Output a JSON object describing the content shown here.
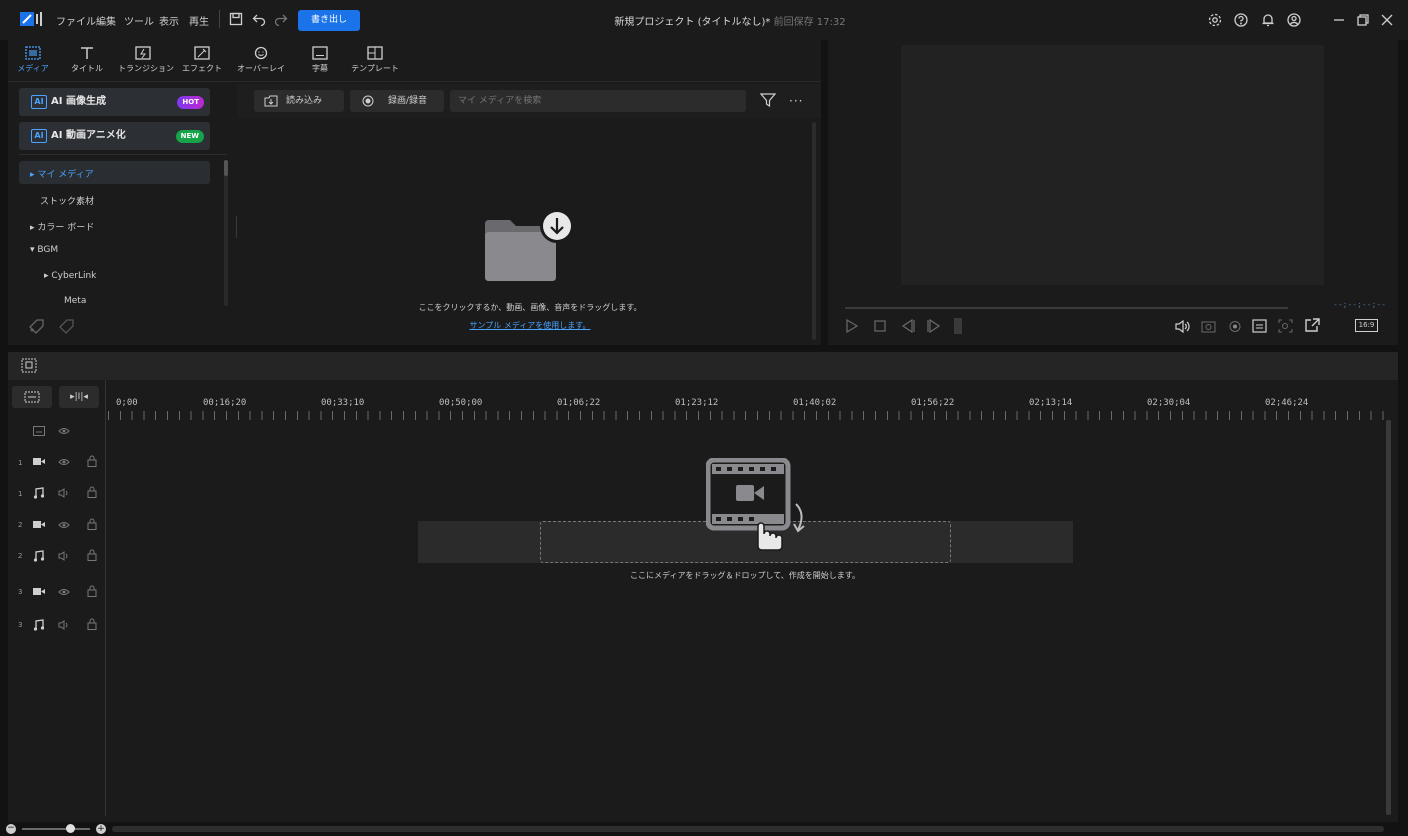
{
  "titlebar": {
    "menu": [
      "ファイル",
      "編集",
      "ツール",
      "表示",
      "再生"
    ],
    "export_label": "書き出し",
    "project_title": "新規プロジェクト (タイトルなし)*",
    "last_saved": "前回保存 17:32"
  },
  "tabs": [
    {
      "label": "メディア",
      "icon": "media-icon"
    },
    {
      "label": "タイトル",
      "icon": "title-icon"
    },
    {
      "label": "トランジション",
      "icon": "transition-icon"
    },
    {
      "label": "エフェクト",
      "icon": "effect-icon"
    },
    {
      "label": "オーバーレイ",
      "icon": "overlay-icon"
    },
    {
      "label": "字幕",
      "icon": "subtitle-icon"
    },
    {
      "label": "テンプレート",
      "icon": "template-icon"
    }
  ],
  "sidebar": {
    "ai_image": {
      "label": "AI 画像生成",
      "badge": "HOT"
    },
    "ai_anime": {
      "label": "AI 動画アニメ化",
      "badge": "NEW"
    },
    "items": [
      "▸ マイ メディア",
      "ストック素材",
      "▸ カラー ボード",
      "▾ BGM",
      "▸ CyberLink",
      "Meta"
    ]
  },
  "media_toolbar": {
    "import_label": "読み込み",
    "record_label": "録画/録音",
    "search_placeholder": "マイ メディアを検索"
  },
  "media_empty": {
    "hint": "ここをクリックするか、動画、画像、音声をドラッグします。",
    "sample_link": "サンプル メディアを使用します。"
  },
  "preview": {
    "timecode": "--;--;--;--",
    "aspect": "16:9"
  },
  "timeline": {
    "ticks": [
      "0;00",
      "00;16;20",
      "00;33;10",
      "00;50;00",
      "01;06;22",
      "01;23;12",
      "01;40;02",
      "01;56;22",
      "02;13;14",
      "02;30;04",
      "02;46;24"
    ],
    "track_numbers": [
      "1",
      "1",
      "2",
      "2",
      "3",
      "3"
    ],
    "drop_hint": "ここにメディアをドラッグ＆ドロップして、作成を開始します。"
  },
  "colors": {
    "accent": "#1a73e8",
    "hot_badge": "#a855f7",
    "new_badge": "#22c55e"
  }
}
